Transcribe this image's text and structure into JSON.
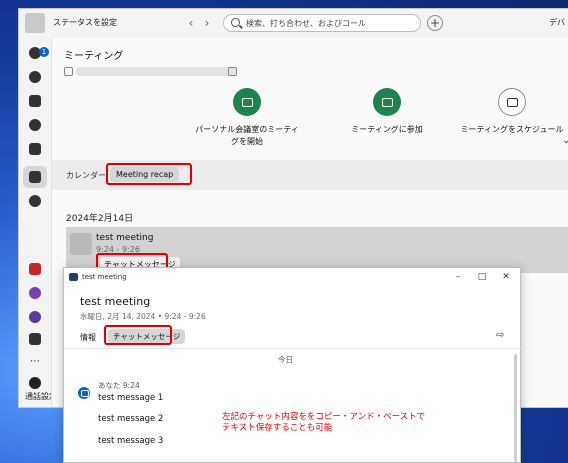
{
  "window": {
    "status_label": "ステータスを設定",
    "search_placeholder": "検索、打ち合わせ、およびコール",
    "right_label": "デバ"
  },
  "rail": {
    "badge_count": "1",
    "bottom_label": "通話設定"
  },
  "content": {
    "title": "ミーティング",
    "actions": [
      {
        "label_line1": "パーソナル会議室のミーティ",
        "label_line2": "グを開始",
        "icon": "video-icon",
        "style": "filled"
      },
      {
        "label_line1": "ミーティングに参加",
        "label_line2": "",
        "icon": "join-icon",
        "style": "filled"
      },
      {
        "label_line1": "ミーティングをスケジュール",
        "label_line2": "",
        "icon": "calendar-plus-icon",
        "style": "outline"
      }
    ],
    "tabs": {
      "calendar": "カレンダー",
      "recap": "Meeting recap"
    },
    "date_heading": "2024年2月14日",
    "recap_item": {
      "title": "test meeting",
      "time": "9:24 - 9:26",
      "chat_button": "チャットメッセージ"
    }
  },
  "popup": {
    "window_title": "test meeting",
    "heading": "test meeting",
    "subheading": "水曜日, 2月 14, 2024 • 9:24 - 9:26",
    "tab_info": "情報",
    "tab_chat": "チャットメッセージ",
    "today_label": "今日",
    "sender": "あなた 9:24",
    "messages": [
      "test message 1",
      "test message 2",
      "test message 3"
    ],
    "annotation_line1": "左記のチャット内容ををコピー・アンド・ペーストで",
    "annotation_line2": "テキスト保存することも可能"
  },
  "colors": {
    "accent_green": "#1d8450",
    "highlight_red": "#e00000",
    "badge_blue": "#0a64c8"
  }
}
